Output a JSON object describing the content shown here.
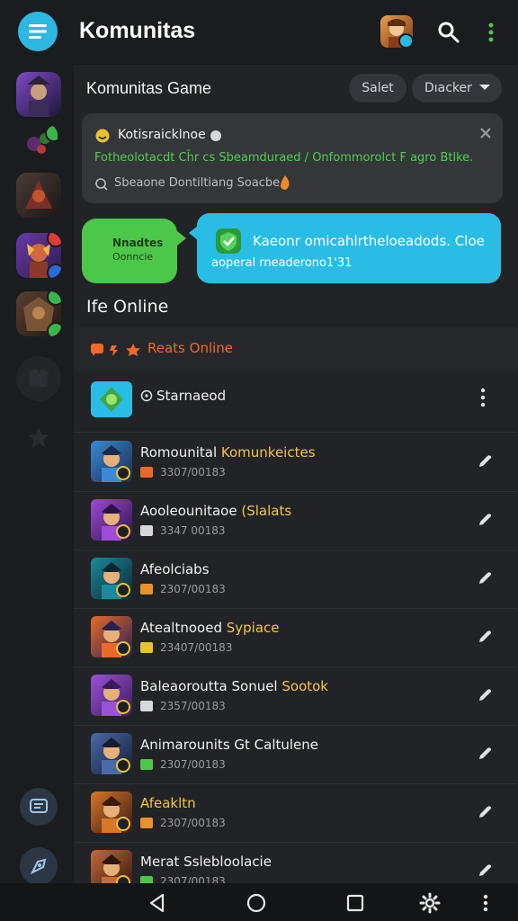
{
  "header": {
    "title": "Komunitas",
    "menu_icon": "hamburger-menu-icon",
    "search_icon": "search-icon",
    "more_icon": "vertical-more-icon"
  },
  "main": {
    "section_title": "Komunitas Game",
    "select_label": "Salet",
    "dropdown_label": "Dıacker"
  },
  "notice": {
    "title": "Kotisraicklnoe",
    "subtitle": "Fotheolotacdt Ch̄r cs Sbeamduraed / Onfommorolct F agro Btlke.",
    "meta": "Sbeaone Dontiltiang Soacbe"
  },
  "chat": {
    "green_line1": "Nnadtes",
    "green_line2": "Oonncie",
    "blue_line1": "Kaeonr omicahlrtheloeadods. Cloe",
    "blue_line2": "aoperal rneaderono1'31"
  },
  "online": {
    "title": "Ife Online",
    "group_label": "Reats Online"
  },
  "list_header": {
    "name": "Starnaeod"
  },
  "members": [
    {
      "name": "Romounital",
      "highlight": " Komunkeictes",
      "time": "3307/00183"
    },
    {
      "name": "Aooleounitaoe",
      "highlight": " (Slalats",
      "time": "3347 00183"
    },
    {
      "name": "Afeolciabs",
      "highlight": "",
      "time": "2307/00183"
    },
    {
      "name": "Atealtnooed",
      "highlight": " Sypiace",
      "time": "23407/00183"
    },
    {
      "name": "Baleaoroutta Sonuel",
      "highlight": " Sootok",
      "time": "2357/00183"
    },
    {
      "name": "Animarounits Gt Caltulene",
      "highlight": "",
      "time": "2307/00183"
    },
    {
      "name": "",
      "highlight": "Afeakltn",
      "time": "2307/00183"
    },
    {
      "name": "Merat Sslebloolacie",
      "highlight": "",
      "time": "2307/00183"
    }
  ],
  "colors": {
    "accent_blue": "#29bde6",
    "accent_green": "#4cc74a",
    "online_orange": "#ef6a26",
    "highlight_yellow": "#f4c542"
  },
  "navigation": {
    "back_icon": "back-triangle-icon",
    "home_icon": "home-circle-icon",
    "recents_icon": "recents-square-icon",
    "settings_icon": "gear-icon",
    "more_icon": "vertical-more-icon"
  }
}
